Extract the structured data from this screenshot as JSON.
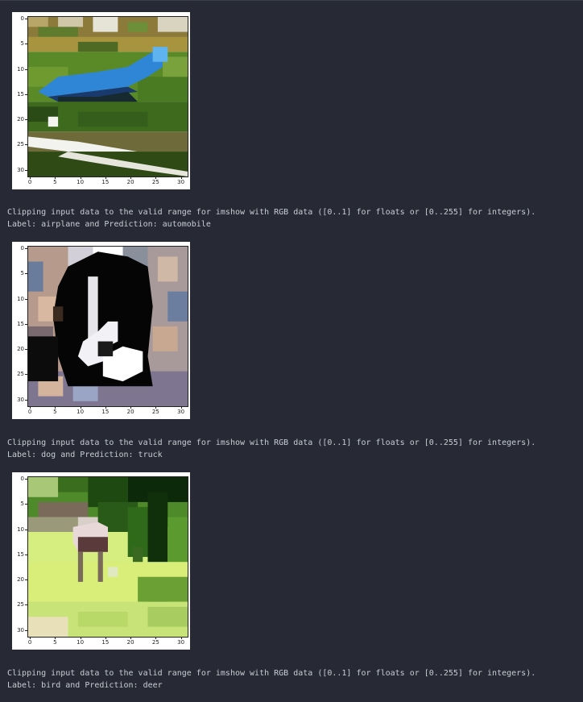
{
  "cells": [
    {
      "warning": "Clipping input data to the valid range for imshow with RGB data ([0..1] for floats or [0..255] for integers).",
      "result": "Label: airplane and Prediction: automobile",
      "scene": "airplane"
    },
    {
      "warning": "Clipping input data to the valid range for imshow with RGB data ([0..1] for floats or [0..255] for integers).",
      "result": "Label: dog and Prediction: truck",
      "scene": "dog"
    },
    {
      "warning": "Clipping input data to the valid range for imshow with RGB data ([0..1] for floats or [0..255] for integers).",
      "result": "Label: bird and Prediction: deer",
      "scene": "bird"
    }
  ],
  "axes": {
    "y_ticks": [
      "0",
      "5",
      "10",
      "15",
      "20",
      "25",
      "30"
    ],
    "x_ticks": [
      "0",
      "5",
      "10",
      "15",
      "20",
      "25",
      "30"
    ]
  },
  "colors": {
    "background": "#272a34",
    "text": "#c8ccd4"
  }
}
